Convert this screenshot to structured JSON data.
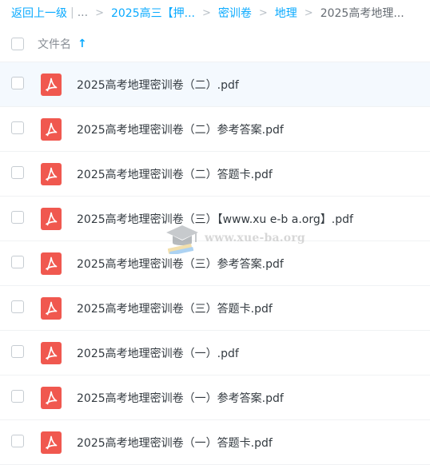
{
  "breadcrumb": {
    "back": "返回上一级",
    "pipe": "|",
    "ellipsis": "...",
    "sep": ">",
    "items": [
      "2025高三【押...",
      "密训卷",
      "地理"
    ],
    "current": "2025高考地理..."
  },
  "header": {
    "column_title": "文件名",
    "sort_icon": "arrow-up-icon",
    "sort_glyph": "↑"
  },
  "files": [
    {
      "name": "2025高考地理密训卷（二）.pdf",
      "icon": "pdf-icon"
    },
    {
      "name": "2025高考地理密训卷（二）参考答案.pdf",
      "icon": "pdf-icon"
    },
    {
      "name": "2025高考地理密训卷（二）答题卡.pdf",
      "icon": "pdf-icon"
    },
    {
      "name": "2025高考地理密训卷（三）【www.xu e-b a.org】.pdf",
      "icon": "pdf-icon"
    },
    {
      "name": "2025高考地理密训卷（三）参考答案.pdf",
      "icon": "pdf-icon"
    },
    {
      "name": "2025高考地理密训卷（三）答题卡.pdf",
      "icon": "pdf-icon"
    },
    {
      "name": "2025高考地理密训卷（一）.pdf",
      "icon": "pdf-icon"
    },
    {
      "name": "2025高考地理密训卷（一）参考答案.pdf",
      "icon": "pdf-icon"
    },
    {
      "name": "2025高考地理密训卷（一）答题卡.pdf",
      "icon": "pdf-icon"
    }
  ],
  "watermark": {
    "text": "www.xue-ba.org",
    "icon": "graduation-cap-icon"
  },
  "colors": {
    "accent": "#09aaff",
    "pdf_red": "#f0584f",
    "row_highlight": "#f4f9fe"
  }
}
